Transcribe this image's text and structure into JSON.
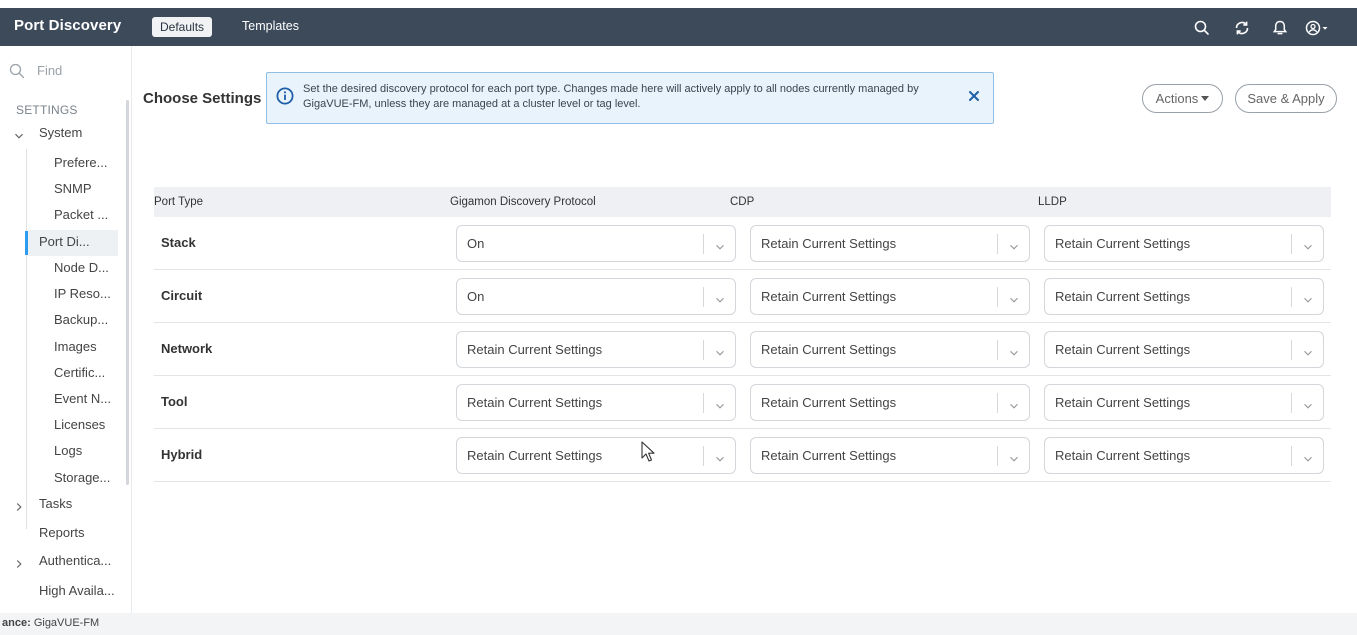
{
  "header": {
    "app_title": "Port Discovery",
    "tabs": [
      {
        "label": "Defaults",
        "active": true
      },
      {
        "label": "Templates",
        "active": false
      }
    ],
    "icons": [
      "search-icon",
      "refresh-icon",
      "bell-icon",
      "user-icon"
    ]
  },
  "sidebar": {
    "search_placeholder": "Find",
    "section_label": "SETTINGS",
    "system_label": "System",
    "system_items": [
      {
        "label": "Prefere..."
      },
      {
        "label": "SNMP"
      },
      {
        "label": "Packet ..."
      },
      {
        "label": "Port Di...",
        "active": true
      },
      {
        "label": "Node D..."
      },
      {
        "label": "IP Reso..."
      },
      {
        "label": "Backup..."
      },
      {
        "label": "Images"
      },
      {
        "label": "Certific..."
      },
      {
        "label": "Event N..."
      },
      {
        "label": "Licenses"
      },
      {
        "label": "Logs"
      },
      {
        "label": "Storage..."
      }
    ],
    "tasks_label": "Tasks",
    "reports_label": "Reports",
    "authentication_label": "Authentica...",
    "high_availability_label": "High Availa..."
  },
  "main": {
    "title": "Choose Settings",
    "info_message": "Set the desired discovery protocol for each port type. Changes made here will actively apply to all nodes currently managed by GigaVUE-FM, unless they are managed at a cluster level or tag level.",
    "actions_label": "Actions",
    "save_apply_label": "Save & Apply",
    "table": {
      "columns": [
        "Port Type",
        "Gigamon Discovery Protocol",
        "CDP",
        "LLDP"
      ],
      "rows": [
        {
          "port_type": "Stack",
          "gdp": "On",
          "cdp": "Retain Current Settings",
          "lldp": "Retain Current Settings"
        },
        {
          "port_type": "Circuit",
          "gdp": "On",
          "cdp": "Retain Current Settings",
          "lldp": "Retain Current Settings"
        },
        {
          "port_type": "Network",
          "gdp": "Retain Current Settings",
          "cdp": "Retain Current Settings",
          "lldp": "Retain Current Settings"
        },
        {
          "port_type": "Tool",
          "gdp": "Retain Current Settings",
          "cdp": "Retain Current Settings",
          "lldp": "Retain Current Settings"
        },
        {
          "port_type": "Hybrid",
          "gdp": "Retain Current Settings",
          "cdp": "Retain Current Settings",
          "lldp": "Retain Current Settings"
        }
      ]
    }
  },
  "footer": {
    "label": "ance:",
    "value": "GigaVUE-FM"
  },
  "colors": {
    "header_bg": "#3d4a5a",
    "accent": "#2d9bf0",
    "info_bg": "#e9f3fc",
    "info_border": "#8fbfe6"
  }
}
